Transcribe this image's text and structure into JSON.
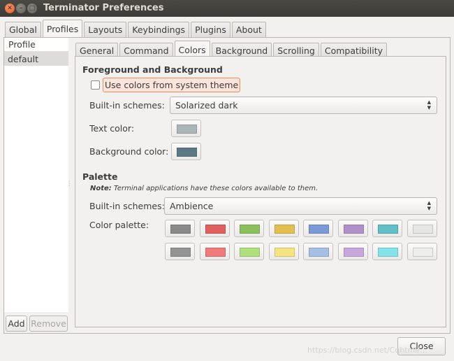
{
  "window": {
    "title": "Terminator Preferences",
    "controls": [
      "close-icon",
      "minimize-icon",
      "maximize-icon"
    ]
  },
  "main_tabs": [
    "Global",
    "Profiles",
    "Layouts",
    "Keybindings",
    "Plugins",
    "About"
  ],
  "main_tab_active": "Profiles",
  "profiles": {
    "header": "Profile",
    "items": [
      "default"
    ],
    "selected": "default",
    "add_label": "Add",
    "remove_label": "Remove"
  },
  "sub_tabs": [
    "General",
    "Command",
    "Colors",
    "Background",
    "Scrolling",
    "Compatibility"
  ],
  "sub_tab_active": "Colors",
  "fg_bg": {
    "title": "Foreground and Background",
    "use_system_label": "Use colors from system theme",
    "use_system_checked": false,
    "schemes_label": "Built-in schemes:",
    "schemes_value": "Solarized dark",
    "text_color_label": "Text color:",
    "text_color": "#aab5b8",
    "bg_color_label": "Background color:",
    "bg_color": "#5b7884"
  },
  "palette": {
    "title": "Palette",
    "note_bold": "Note:",
    "note_text": "Terminal applications have these colors available to them.",
    "schemes_label": "Built-in schemes:",
    "schemes_value": "Ambience",
    "palette_label": "Color palette:",
    "row1": [
      "#8a8a8a",
      "#e06060",
      "#8cc05c",
      "#e2c050",
      "#7a9ad6",
      "#b090c8",
      "#60c0c6",
      "#e6e6e2"
    ],
    "row2": [
      "#949494",
      "#f07a7a",
      "#b0e07c",
      "#f6e480",
      "#a4bee6",
      "#c8a8dc",
      "#84e2ea",
      "#eeeeea"
    ]
  },
  "close_label": "Close",
  "watermark": "https://blog.csdn.net/Cqhtml/..."
}
